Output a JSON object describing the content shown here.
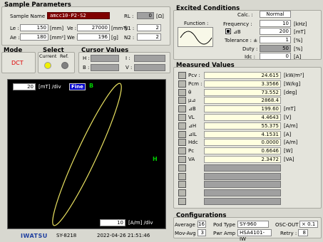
{
  "sample": {
    "title": "Sample Parameters",
    "name_label": "Sample Name :",
    "name_value": "amcc10-P2-S2",
    "rl_label": "RL :",
    "rl_value": "0",
    "rl_unit": "[Ω]",
    "le_label": "Le :",
    "le_value": "150",
    "le_unit": "[mm]",
    "ve_label": "Ve :",
    "ve_value": "27000",
    "ve_unit": "[mm³]",
    "n1_label": "N1 :",
    "n1_value": "2",
    "ae_label": "Ae :",
    "ae_value": "180",
    "ae_unit": "[mm²]",
    "we_label": "We :",
    "we_value": "196",
    "we_unit": "[g]",
    "n2_label": "N2 :",
    "n2_value": "2"
  },
  "mode": {
    "title": "Mode",
    "value": "DCT"
  },
  "select": {
    "title": "Select",
    "current": "Current",
    "ref": "Ref.",
    "colors": {
      "current": "#f0f000",
      "ref": "#808080"
    }
  },
  "cursor": {
    "title": "Cursor Values",
    "h": "H :",
    "i": "I :",
    "b": "B :",
    "v": "V :"
  },
  "excited": {
    "title": "Excited Conditions",
    "function_label": "Function :",
    "calc_label": "Calc. :",
    "calc_value": "Normal",
    "freq_label": "Frequency :",
    "freq_value": "10",
    "freq_unit": "[kHz]",
    "db_label": "⊿B",
    "db_value": "200",
    "db_unit": "[mT]",
    "tol_label": "Tolerance : ±",
    "tol_value": "1",
    "tol_unit": "[%]",
    "duty_label": "Duty :",
    "duty_value": "50",
    "duty_unit": "[%]",
    "idc_label": "Idc :",
    "idc_value": "0",
    "idc_unit": "[A]"
  },
  "scope": {
    "y_scale": "20",
    "y_unit": "[mT] /div",
    "fine": "Fine",
    "b_label": "B",
    "h_label": "H",
    "x_scale": "10",
    "x_unit": "[A/m] /div",
    "trace_color": "#e8e060"
  },
  "measured": {
    "title": "Measured Values",
    "rows": [
      {
        "label": "Pcv :",
        "value": "24.615",
        "unit": "[kW/m³]"
      },
      {
        "label": "Pcm :",
        "value": "3.3566",
        "unit": "[W/kg]"
      },
      {
        "label": "θ",
        "value": "73.552",
        "unit": "[deg]"
      },
      {
        "label": "μ⊿",
        "value": "2868.4",
        "unit": ""
      },
      {
        "label": "⊿B",
        "value": "199.60",
        "unit": "[mT]"
      },
      {
        "label": "VL",
        "value": "4.4643",
        "unit": "[V]"
      },
      {
        "label": "⊿H",
        "value": "55.375",
        "unit": "[A/m]"
      },
      {
        "label": "⊿IL",
        "value": "4.1531",
        "unit": "[A]"
      },
      {
        "label": "Hdc",
        "value": "0.0000",
        "unit": "[A/m]"
      },
      {
        "label": "Pc",
        "value": "0.6646",
        "unit": "[W]"
      },
      {
        "label": "VA",
        "value": "2.3472",
        "unit": "[VA]"
      }
    ],
    "empty_rows": 5
  },
  "config": {
    "title": "Configurations",
    "avg_label": "Average :",
    "avg_value": "16",
    "pod_label": "Pod Type :",
    "pod_value": "SY-960",
    "osc_label": "OSC-OUT :",
    "osc_value": "× 0.1",
    "mov_label": "Mov-Avg :",
    "mov_value": "3",
    "pwr_label": "Pwr Amp :",
    "pwr_value": "HSA4101-IW",
    "retry_label": "Retry :",
    "retry_value": "8"
  },
  "footer": {
    "brand": "IWATSU",
    "model": "SY-8218",
    "datetime": "2022-04-26 21:51:46"
  }
}
